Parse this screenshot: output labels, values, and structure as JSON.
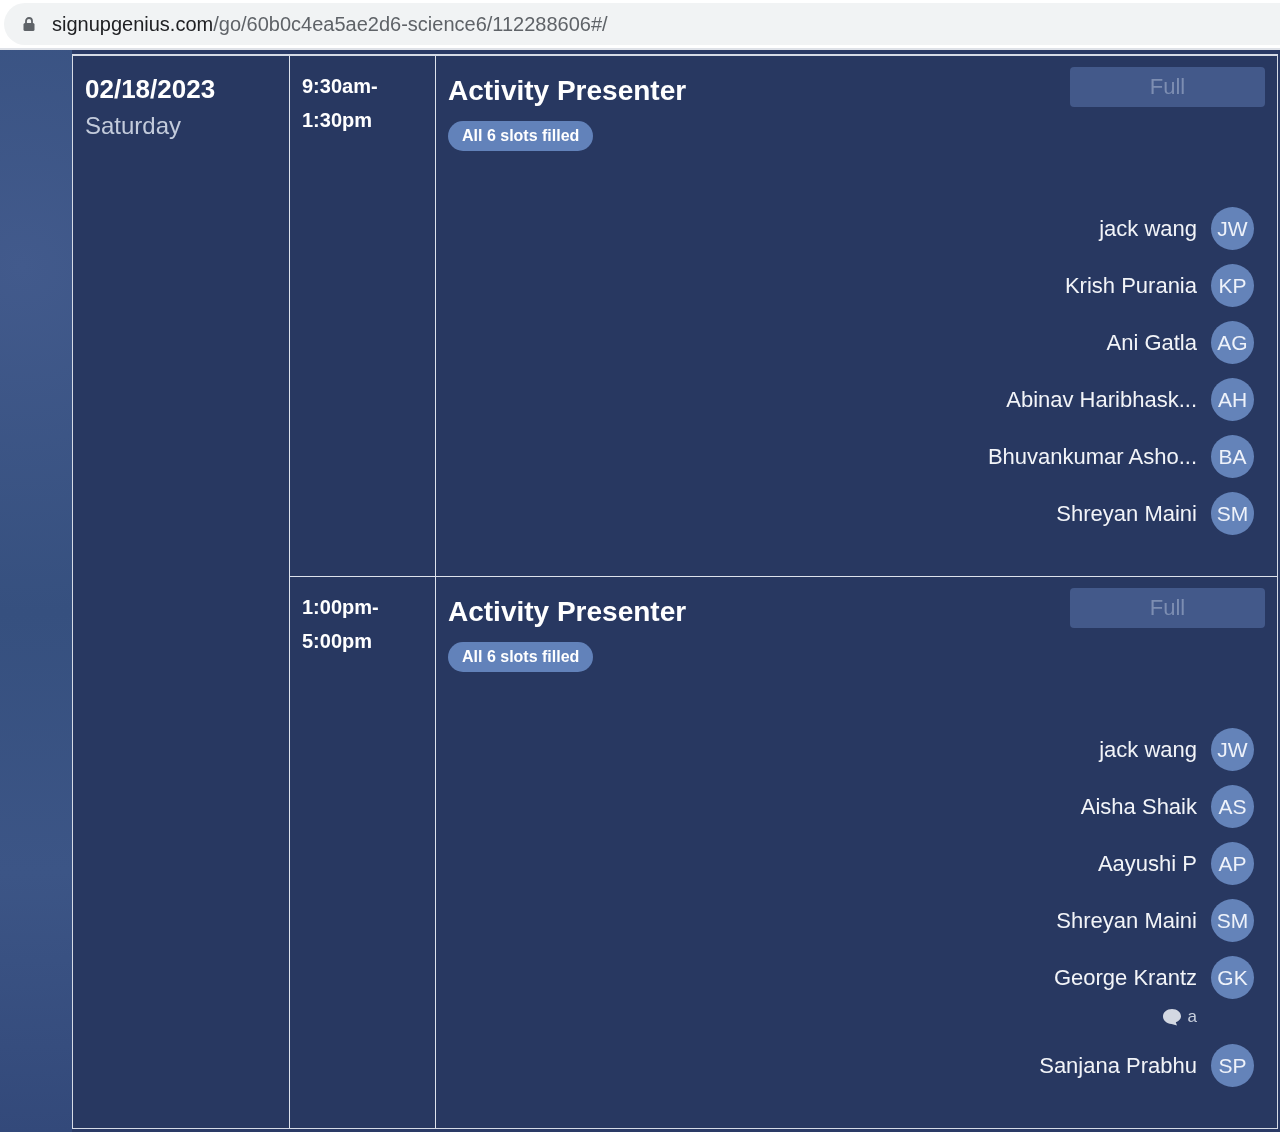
{
  "browser": {
    "url_host": "signupgenius.com",
    "url_path": "/go/60b0c4ea5ae2d6-science6/112288606#/"
  },
  "date": {
    "date": "02/18/2023",
    "weekday": "Saturday"
  },
  "slots": [
    {
      "time": "9:30am-1:30pm",
      "title": "Activity Presenter",
      "badge": "All 6 slots filled",
      "button": {
        "label": "Full",
        "disabled": true
      },
      "volunteers": [
        {
          "name": "jack wang",
          "initials": "JW"
        },
        {
          "name": "Krish Purania",
          "initials": "KP"
        },
        {
          "name": "Ani Gatla",
          "initials": "AG"
        },
        {
          "name": "Abinav Haribhask...",
          "initials": "AH"
        },
        {
          "name": "Bhuvankumar Asho...",
          "initials": "BA"
        },
        {
          "name": "Shreyan Maini",
          "initials": "SM"
        }
      ]
    },
    {
      "time": "1:00pm-5:00pm",
      "title": "Activity Presenter",
      "badge": "All 6 slots filled",
      "button": {
        "label": "Full",
        "disabled": true
      },
      "volunteers": [
        {
          "name": "jack wang",
          "initials": "JW"
        },
        {
          "name": "Aisha Shaik",
          "initials": "AS"
        },
        {
          "name": "Aayushi P",
          "initials": "AP"
        },
        {
          "name": "Shreyan Maini",
          "initials": "SM"
        },
        {
          "name": "George Krantz",
          "initials": "GK",
          "comment": "a"
        },
        {
          "name": "Sanjana Prabhu",
          "initials": "SP"
        }
      ]
    }
  ]
}
